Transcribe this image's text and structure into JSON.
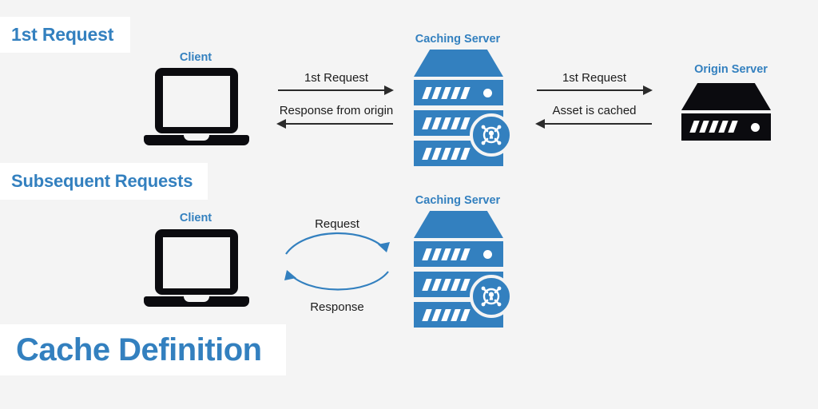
{
  "page": {
    "background_color": "#f4f4f4",
    "accent_color": "#3380bf",
    "ink_color": "#0b0b0f"
  },
  "banners": {
    "first_request": "1st Request",
    "subsequent_requests": "Subsequent Requests",
    "title": "Cache Definition"
  },
  "row1": {
    "client_caption": "Client",
    "caching_server_caption": "Caching Server",
    "origin_server_caption": "Origin Server",
    "arrows": {
      "client_to_cache": "1st Request",
      "cache_to_client": "Response from origin",
      "cache_to_origin": "1st Request",
      "origin_to_cache": "Asset is cached"
    }
  },
  "row2": {
    "client_caption": "Client",
    "caching_server_caption": "Caching Server",
    "arrows": {
      "request": "Request",
      "response": "Response"
    }
  },
  "icons": {
    "laptop": "laptop-icon",
    "server_stack": "server-stack-icon",
    "cache_badge": "cache-lock-badge-icon",
    "arrow_right": "arrow-right-icon",
    "arrow_left": "arrow-left-icon",
    "curved_arrow": "curved-arrow-icon"
  }
}
